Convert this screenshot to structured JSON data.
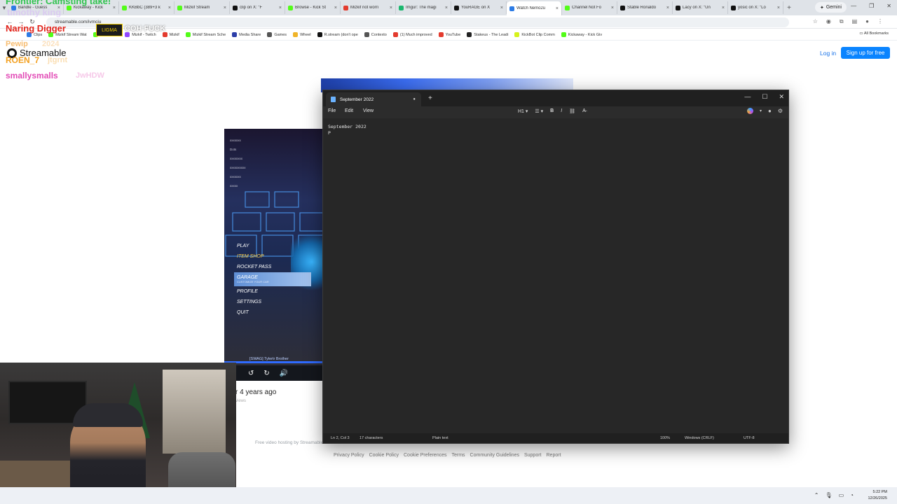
{
  "browser": {
    "tabs": [
      {
        "label": "Bandle - Guess",
        "color": "#2c7be5"
      },
      {
        "label": "Kickaway - Kick",
        "color": "#53fc18"
      },
      {
        "label": "KKBbC (389+3 k",
        "color": "#53fc18"
      },
      {
        "label": "Mizkif Stream",
        "color": "#53fc18"
      },
      {
        "label": "clip on X: \"F",
        "color": "#111111"
      },
      {
        "label": "Browse - Kick St",
        "color": "#53fc18"
      },
      {
        "label": "Mizkif not worri",
        "color": "#e33b2e"
      },
      {
        "label": "Imgur: The magi",
        "color": "#1bb76e"
      },
      {
        "label": "YouRAGE on X",
        "color": "#111111"
      },
      {
        "label": "Watch Nemo2u",
        "color": "#2c7be5"
      },
      {
        "label": "Channel Not Fo",
        "color": "#53fc18"
      },
      {
        "label": "Stable Ronaldo",
        "color": "#111111"
      },
      {
        "label": "Lacy on X: \"Un",
        "color": "#111111"
      },
      {
        "label": "yosic on X: \"Lo",
        "color": "#111111"
      }
    ],
    "active_tab_index": 9,
    "gemini_label": "Gemini",
    "url": "streamable.com/ivmciu",
    "bookmarks": [
      {
        "label": "Clips",
        "color": "#2c7be5"
      },
      {
        "label": "Mizkif Stream Wat",
        "color": "#53fc18"
      },
      {
        "label": "Kick Chatb",
        "color": "#53fc18"
      },
      {
        "label": "Mizkif - Twitch",
        "color": "#9147ff"
      },
      {
        "label": "Mizkif",
        "color": "#e33b2e"
      },
      {
        "label": "Mizkif Stream Sche",
        "color": "#53fc18"
      },
      {
        "label": "Media Share",
        "color": "#2c3ea8"
      },
      {
        "label": "Games",
        "color": "#555555"
      },
      {
        "label": "Wheel",
        "color": "#f0b429"
      },
      {
        "label": "R.stream (don't ope",
        "color": "#111111"
      },
      {
        "label": "Contexto",
        "color": "#555555"
      },
      {
        "label": "(1) Much improved",
        "color": "#e33b2e"
      },
      {
        "label": "YouTube",
        "color": "#e33b2e"
      },
      {
        "label": "Stakeus - The Leadi",
        "color": "#222222"
      },
      {
        "label": "KickBot Clip Comm",
        "color": "#d6f21c"
      },
      {
        "label": "Kickaway - Kick Giv",
        "color": "#53fc18"
      }
    ],
    "all_bookmarks_label": "All Bookmarks"
  },
  "streamable": {
    "logo_text": "Streamable",
    "login_label": "Log in",
    "signup_label": "Sign up for free",
    "uploaded_text": "r 4 years ago",
    "views_text": "views",
    "hosting_text": "Free video hosting by Streamable",
    "footer_links": [
      "Privacy Policy",
      "Cookie Policy",
      "Cookie Preferences",
      "Terms",
      "Community Guidelines",
      "Support",
      "Report"
    ]
  },
  "game": {
    "menu": [
      "PLAY",
      "ITEM SHOP",
      "ROCKET PASS",
      "GARAGE",
      "PROFILE",
      "SETTINGS",
      "QUIT"
    ],
    "garage_sub": "CUSTOMIZE YOUR CAR",
    "player_tag": "[SWAG] Tylertr Brother",
    "chat_lines": [
      "xxxxxxx",
      "Dots",
      "xxxxxxxx",
      "xxxxxxxxxx",
      "xxxxxxx",
      "xxxxx"
    ],
    "video_progress": 1.0
  },
  "overlay": {
    "top_text": "Frontier: Camsting take!",
    "tiny_text": "timothy king",
    "naring": "Naring Digger",
    "emote": "LIGMA",
    "ligma_tail": "COH FUCK",
    "pewip": "Pewip",
    "pewip_tail": "2024",
    "roen": "ROEN_7",
    "roen_tail": "jtgrnt",
    "smally": "smallysmalls",
    "smally_tail": "JwHDW"
  },
  "notepad": {
    "tab_title": "September 2022",
    "menu": [
      "File",
      "Edit",
      "View"
    ],
    "heading_label": "H1",
    "content_line1": "September 2022",
    "content_line2": "P",
    "status": {
      "position": "Ln 2, Col 3",
      "characters": "17 characters",
      "format": "Plain text",
      "zoom": "100%",
      "line_endings": "Windows (CRLF)",
      "encoding": "UTF-8"
    }
  },
  "taskbar": {
    "time": "5:22 PM",
    "date": "12/26/2025"
  }
}
